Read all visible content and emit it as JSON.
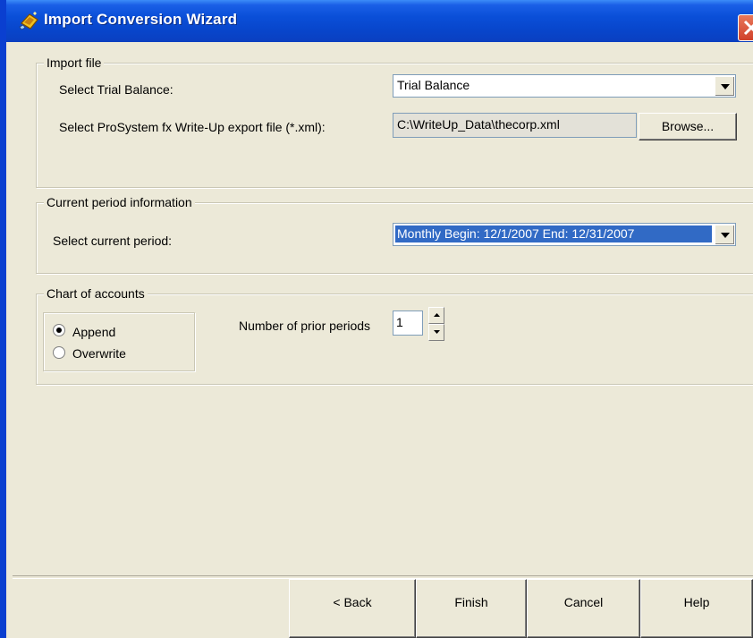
{
  "window": {
    "title": "Import Conversion Wizard"
  },
  "import_file": {
    "legend": "Import file",
    "trial_balance_label": "Select Trial Balance:",
    "trial_balance_value": "Trial Balance",
    "export_file_label": "Select ProSystem fx Write-Up export file (*.xml):",
    "export_file_value": "C:\\WriteUp_Data\\thecorp.xml",
    "browse_label": "Browse..."
  },
  "current_period": {
    "legend": "Current period information",
    "period_label": "Select current period:",
    "period_value": "Monthly Begin: 12/1/2007  End: 12/31/2007"
  },
  "chart_of_accounts": {
    "legend": "Chart of accounts",
    "options": [
      {
        "label": "Append",
        "selected": true
      },
      {
        "label": "Overwrite",
        "selected": false
      }
    ],
    "prior_periods_label": "Number of prior periods",
    "prior_periods_value": "1"
  },
  "footer": {
    "back_label": "< Back",
    "finish_label": "Finish",
    "cancel_label": "Cancel",
    "help_label": "Help"
  }
}
